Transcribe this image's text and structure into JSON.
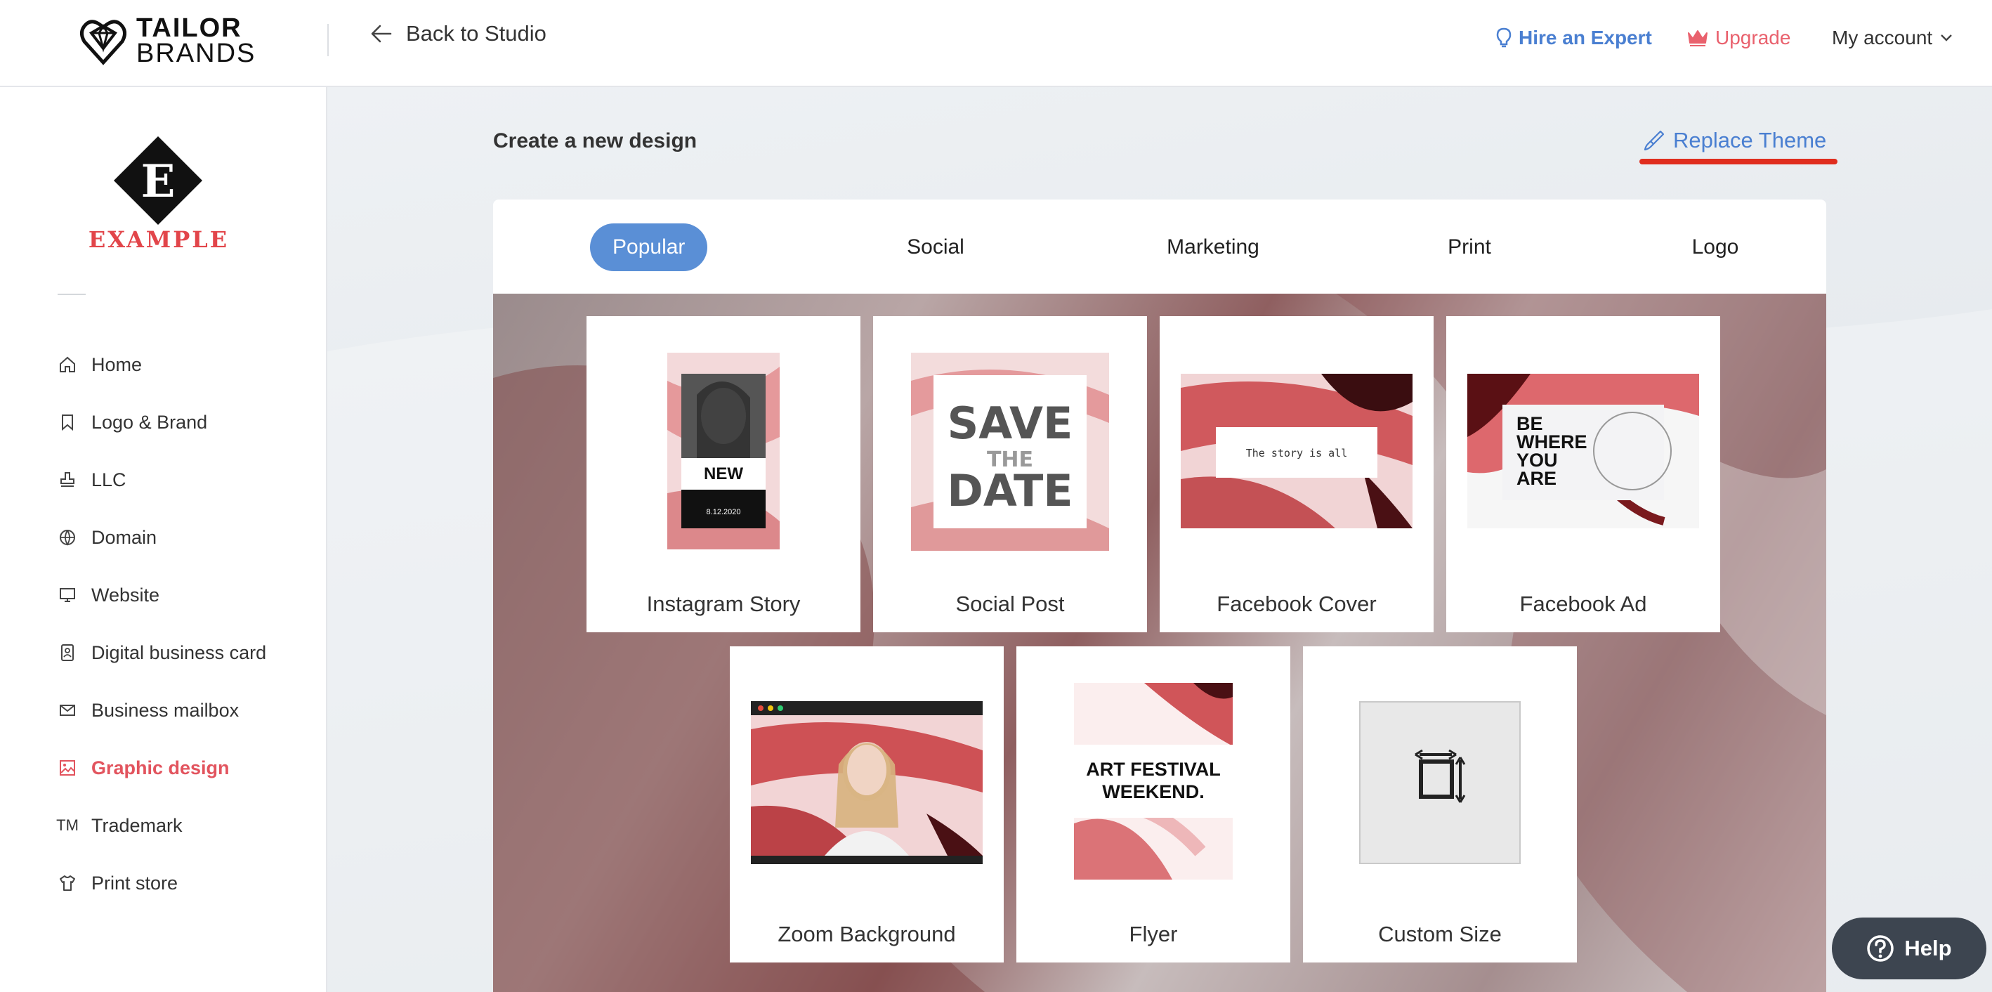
{
  "header": {
    "logo_line1": "TAILOR",
    "logo_line2": "BRANDS",
    "back_label": "Back to Studio",
    "hire_label": "Hire an Expert",
    "upgrade_label": "Upgrade",
    "account_label": "My account"
  },
  "sidebar": {
    "brand_letter": "E",
    "brand_name": "EXAMPLE",
    "items": [
      {
        "label": "Home",
        "icon": "home-icon"
      },
      {
        "label": "Logo & Brand",
        "icon": "bookmark-icon"
      },
      {
        "label": "LLC",
        "icon": "stamp-icon"
      },
      {
        "label": "Domain",
        "icon": "globe-icon"
      },
      {
        "label": "Website",
        "icon": "monitor-icon"
      },
      {
        "label": "Digital business card",
        "icon": "id-card-icon"
      },
      {
        "label": "Business mailbox",
        "icon": "mail-icon"
      },
      {
        "label": "Graphic design",
        "icon": "image-icon",
        "active": true
      },
      {
        "label": "Trademark",
        "icon": "tm-icon",
        "glyph": "TM"
      },
      {
        "label": "Print store",
        "icon": "tshirt-icon"
      }
    ],
    "active_color": "#e2545e"
  },
  "main": {
    "title": "Create a new design",
    "replace_label": "Replace Theme",
    "tabs": [
      {
        "label": "Popular",
        "active": true
      },
      {
        "label": "Social"
      },
      {
        "label": "Marketing"
      },
      {
        "label": "Print"
      },
      {
        "label": "Logo"
      }
    ],
    "cards": [
      {
        "label": "Instagram Story",
        "thumb_text": "NEW",
        "thumb_sub": "8.12.2020"
      },
      {
        "label": "Social Post",
        "thumb_text_1": "SAVE",
        "thumb_text_2": "THE",
        "thumb_text_3": "DATE"
      },
      {
        "label": "Facebook Cover",
        "thumb_text": "The story is all"
      },
      {
        "label": "Facebook Ad",
        "thumb_text_1": "BE",
        "thumb_text_2": "WHERE",
        "thumb_text_3": "YOU",
        "thumb_text_4": "ARE"
      },
      {
        "label": "Zoom Background"
      },
      {
        "label": "Flyer",
        "thumb_text_1": "ART FESTIVAL",
        "thumb_text_2": "WEEKEND."
      },
      {
        "label": "Custom Size"
      }
    ]
  },
  "help": {
    "label": "Help"
  },
  "colors": {
    "accent_blue": "#4a7fd1",
    "tab_active": "#5a8fd6",
    "brand_red": "#e2454a",
    "underline_red": "#e02d1e"
  }
}
